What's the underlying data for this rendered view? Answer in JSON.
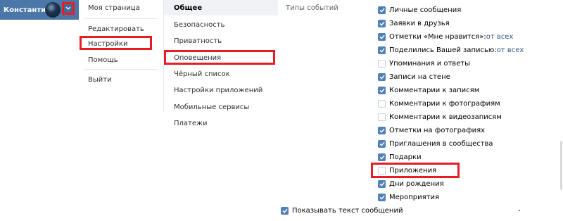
{
  "user": {
    "name": "Константин"
  },
  "menu": {
    "items": [
      {
        "label": "Моя страница"
      },
      {
        "label": "Редактировать"
      },
      {
        "label": "Настройки"
      },
      {
        "label": "Помощь"
      },
      {
        "label": "Выйти"
      }
    ]
  },
  "nav": {
    "items": [
      {
        "label": "Общее"
      },
      {
        "label": "Безопасность"
      },
      {
        "label": "Приватность"
      },
      {
        "label": "Оповещения"
      },
      {
        "label": "Чёрный список"
      },
      {
        "label": "Настройки приложений"
      },
      {
        "label": "Мобильные сервисы"
      },
      {
        "label": "Платежи"
      }
    ]
  },
  "events": {
    "label": "Типы событий",
    "options": [
      {
        "label": "Личные сообщения",
        "extra": "",
        "checked": true
      },
      {
        "label": "Заявки в друзья",
        "extra": "",
        "checked": true
      },
      {
        "label": "Отметки «Мне нравится»: ",
        "extra": "от всех",
        "checked": true
      },
      {
        "label": "Поделились Вашей записью: ",
        "extra": "от всех",
        "checked": true
      },
      {
        "label": "Упоминания и ответы",
        "extra": "",
        "checked": false
      },
      {
        "label": "Записи на стене",
        "extra": "",
        "checked": true
      },
      {
        "label": "Комментарии к записям",
        "extra": "",
        "checked": true
      },
      {
        "label": "Комментарии к фотографиям",
        "extra": "",
        "checked": false
      },
      {
        "label": "Комментарии к видеозаписям",
        "extra": "",
        "checked": false
      },
      {
        "label": "Отметки на фотографиях",
        "extra": "",
        "checked": true
      },
      {
        "label": "Приглашения в сообщества",
        "extra": "",
        "checked": true
      },
      {
        "label": "Подарки",
        "extra": "",
        "checked": true
      },
      {
        "label": "Приложения",
        "extra": "",
        "checked": false
      },
      {
        "label": "Дни рождения",
        "extra": "",
        "checked": true
      },
      {
        "label": "Мероприятия",
        "extra": "",
        "checked": true
      }
    ],
    "show_text": {
      "label": "Показывать текст сообщений",
      "checked": true
    }
  },
  "colors": {
    "header": "#4a76a8",
    "accent": "#5181b8",
    "highlight": "#e81c24",
    "link": "#2a5885"
  }
}
